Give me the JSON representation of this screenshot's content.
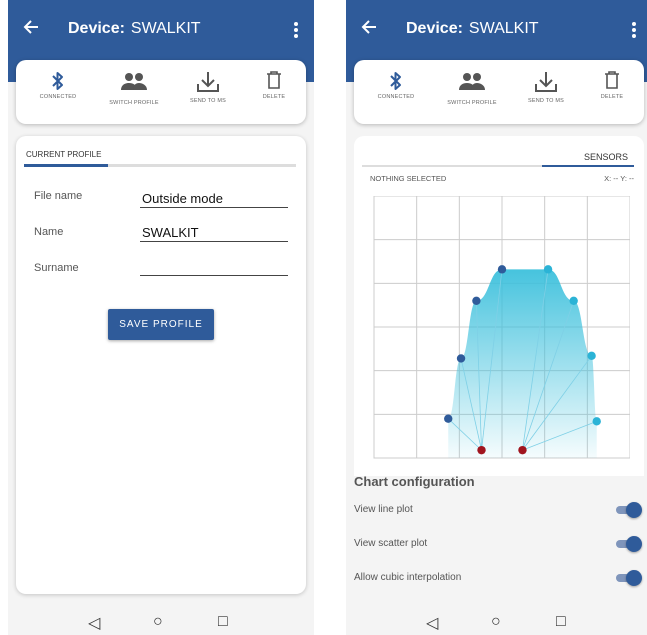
{
  "header": {
    "title_prefix": "Device:",
    "device_name": "SWALKIT"
  },
  "toolbar": {
    "connected": "CONNECTED",
    "switch_profile": "SWITCH PROFILE",
    "send_to_ms": "SEND TO MS",
    "delete": "DELETE"
  },
  "profile": {
    "tab_label": "CURRENT PROFILE",
    "fields": [
      {
        "label": "File name",
        "value": "Outside mode"
      },
      {
        "label": "Name",
        "value": "SWALKIT"
      },
      {
        "label": "Surname",
        "value": ""
      }
    ],
    "save_label": "SAVE PROFILE"
  },
  "sensors": {
    "tab_label": "SENSORS",
    "selection": "NOTHING SELECTED",
    "coords": "X: -- Y: --"
  },
  "chart_data": {
    "type": "scatter",
    "grid": true,
    "points": [
      {
        "x": 0.29,
        "y": 0.15,
        "color": "#2f5b9a"
      },
      {
        "x": 0.34,
        "y": 0.38,
        "color": "#2f5b9a"
      },
      {
        "x": 0.4,
        "y": 0.6,
        "color": "#2f5b9a"
      },
      {
        "x": 0.5,
        "y": 0.72,
        "color": "#2f5b9a"
      },
      {
        "x": 0.68,
        "y": 0.72,
        "color": "#2bb3d6"
      },
      {
        "x": 0.78,
        "y": 0.6,
        "color": "#2bb3d6"
      },
      {
        "x": 0.85,
        "y": 0.39,
        "color": "#2bb3d6"
      },
      {
        "x": 0.87,
        "y": 0.14,
        "color": "#2bb3d6"
      },
      {
        "x": 0.42,
        "y": 0.03,
        "color": "#a0141e"
      },
      {
        "x": 0.58,
        "y": 0.03,
        "color": "#a0141e"
      }
    ]
  },
  "config": {
    "title": "Chart configuration",
    "options": [
      {
        "label": "View line plot",
        "on": true
      },
      {
        "label": "View scatter plot",
        "on": true
      },
      {
        "label": "Allow cubic interpolation",
        "on": true
      }
    ]
  },
  "icons": {
    "back": "arrow-back-icon",
    "menu": "more-vert-icon",
    "bluetooth": "bluetooth-icon",
    "people": "people-icon",
    "download": "download-icon",
    "trash": "trash-icon"
  },
  "colors": {
    "primary": "#2f5b9a",
    "accent": "#2bb3d6"
  }
}
